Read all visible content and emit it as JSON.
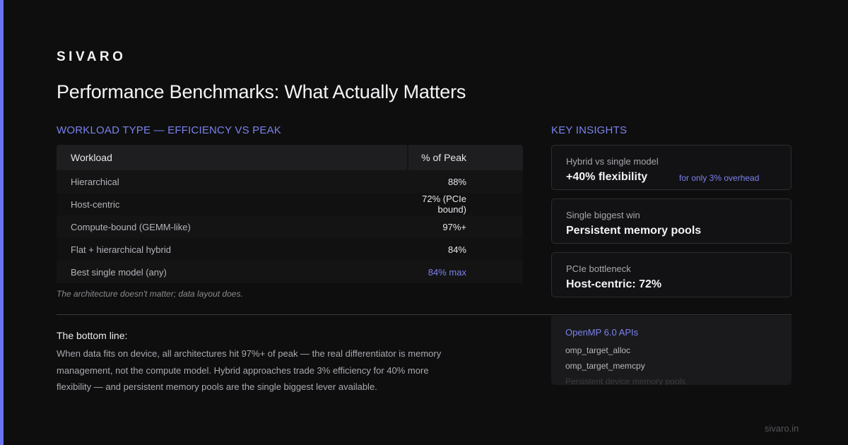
{
  "brand": "SIVARO",
  "title": "Performance Benchmarks: What Actually Matters",
  "workload_section": {
    "label": "WORKLOAD TYPE — EFFICIENCY VS PEAK",
    "columns": [
      "Workload",
      "% of Peak"
    ],
    "rows": [
      {
        "workload": "Hierarchical",
        "peak": "88%"
      },
      {
        "workload": "Host-centric",
        "peak": "72% (PCIe bound)"
      },
      {
        "workload": "Compute-bound (GEMM-like)",
        "peak": "97%+"
      },
      {
        "workload": "Flat + hierarchical hybrid",
        "peak": "84%"
      },
      {
        "workload": "Best single model (any)",
        "peak": "84% max"
      }
    ],
    "caption": "The architecture doesn't matter; data layout does."
  },
  "insights_section": {
    "label": "KEY INSIGHTS",
    "cards": [
      {
        "label": "Hybrid vs single model",
        "value": "+40% flexibility",
        "note": "for only 3% overhead"
      },
      {
        "label": "Single biggest win",
        "value": "Persistent memory pools"
      },
      {
        "label": "PCIe bottleneck",
        "value": "Host-centric: 72%"
      }
    ]
  },
  "bottom_line": {
    "heading": "The bottom line:",
    "body": "When data fits on device, all architectures hit 97%+ of peak — the real differentiator is memory management, not the compute model. Hybrid approaches trade 3% efficiency for 40% more flexibility — and persistent memory pools are the single biggest lever available."
  },
  "api_panel": {
    "title": "OpenMP 6.0 APIs",
    "items": [
      "omp_target_alloc",
      "omp_target_memcpy",
      "Persistent device memory pools"
    ]
  },
  "footer": "sivaro.in",
  "colors": {
    "accent": "#6b73f0",
    "background": "#0e0e0e"
  }
}
